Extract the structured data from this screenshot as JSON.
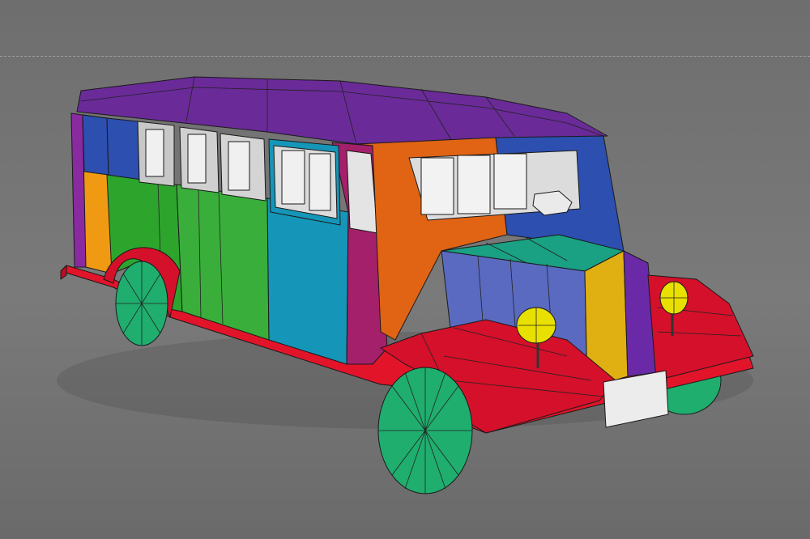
{
  "viewport": {
    "background": "#767676",
    "grid_line_color": "#b0b0b0"
  },
  "model": {
    "palette": {
      "roof": "#6a2a98",
      "front_cap": "#5a2fa8",
      "cowl_orange": "#e06414",
      "cowl_blue": "#2c4fb0",
      "side_purple": "#8a2aa0",
      "side_orange": "#ef9a12",
      "side_green": "#2da52d",
      "side_green2": "#3aae3a",
      "side_cyan": "#1596b8",
      "side_magenta": "#a4206a",
      "hood_teal": "#1aa082",
      "hood_slate": "#5a6ac0",
      "hood_yellow": "#e0b012",
      "hood_violet": "#6a2aa8",
      "fender_red": "#d4102a",
      "skirt_red": "#e2142a",
      "wheel_green": "#1fae6e",
      "headlight_yellow": "#e8e000",
      "plate_white": "#ececec",
      "seat_white": "#f0f0f0"
    }
  }
}
